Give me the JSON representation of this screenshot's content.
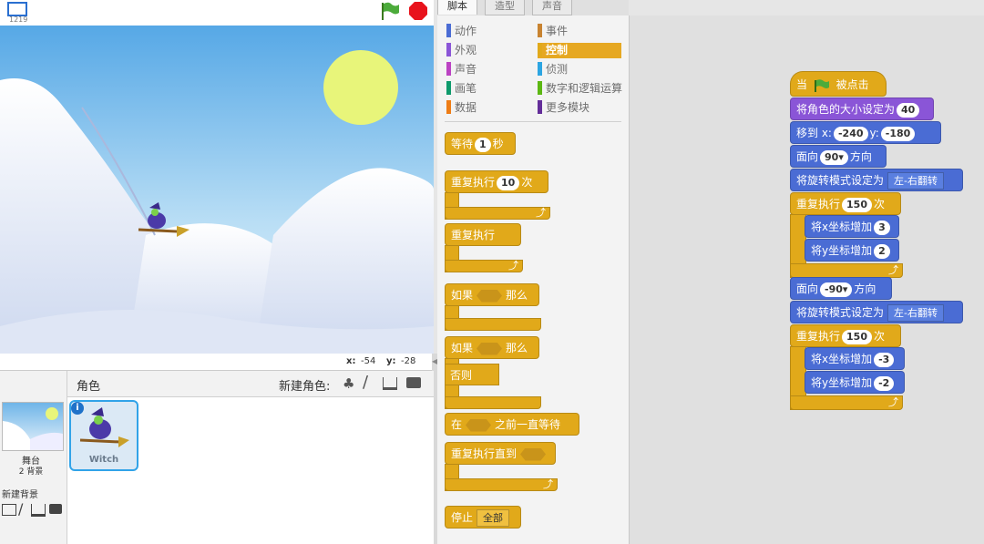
{
  "stage": {
    "version_label": "1219",
    "coord_x_label": "x:",
    "coord_x": "-54",
    "coord_y_label": "y:",
    "coord_y": "-28"
  },
  "sprites": {
    "header_label": "角色",
    "new_sprite_label": "新建角色:",
    "stage_item_label": "舞台",
    "stage_backdrops": "2 背景",
    "new_backdrop_label": "新建背景",
    "sprite_name": "Witch"
  },
  "tabs": [
    {
      "label": "脚本"
    },
    {
      "label": "造型"
    },
    {
      "label": "声音"
    }
  ],
  "categories": [
    {
      "label": "动作",
      "color": "#4a6cd4"
    },
    {
      "label": "事件",
      "color": "#c88330"
    },
    {
      "label": "外观",
      "color": "#8a55d7"
    },
    {
      "label": "控制",
      "color": "#e1a91a"
    },
    {
      "label": "声音",
      "color": "#bb42c3"
    },
    {
      "label": "侦测",
      "color": "#2ca5e2"
    },
    {
      "label": "画笔",
      "color": "#0e9a6c"
    },
    {
      "label": "数字和逻辑运算",
      "color": "#5cb712"
    },
    {
      "label": "数据",
      "color": "#ee7d16"
    },
    {
      "label": "更多模块",
      "color": "#632d99"
    }
  ],
  "palette": {
    "wait_label": "等待",
    "wait_value": "1",
    "wait_unit": "秒",
    "repeat_label": "重复执行",
    "repeat_value": "10",
    "repeat_unit": "次",
    "forever_label": "重复执行",
    "if_label": "如果",
    "then_label": "那么",
    "if2_label": "如果",
    "then2_label": "那么",
    "else_label": "否则",
    "wait_until_pre": "在",
    "wait_until_post": "之前一直等待",
    "repeat_until_label": "重复执行直到",
    "stop_label": "停止",
    "stop_value": "全部"
  },
  "script": {
    "hat_pre": "当",
    "hat_post": "被点击",
    "set_size_label": "将角色的大小设定为",
    "set_size_value": "40",
    "goto_label": "移到 x:",
    "goto_x": "-240",
    "goto_y_label": "y:",
    "goto_y": "-180",
    "point1_label": "面向",
    "point1_value": "90▾",
    "point1_suffix": "方向",
    "rotation1_label": "将旋转模式设定为",
    "rotation1_value": "左-右翻转",
    "repeat1_label": "重复执行",
    "repeat1_value": "150",
    "repeat1_unit": "次",
    "changex1_label": "将x坐标增加",
    "changex1_value": "3",
    "changey1_label": "将y坐标增加",
    "changey1_value": "2",
    "point2_label": "面向",
    "point2_value": "-90▾",
    "point2_suffix": "方向",
    "rotation2_label": "将旋转模式设定为",
    "rotation2_value": "左-右翻转",
    "repeat2_label": "重复执行",
    "repeat2_value": "150",
    "repeat2_unit": "次",
    "changex2_label": "将x坐标增加",
    "changex2_value": "-3",
    "changey2_label": "将y坐标增加",
    "changey2_value": "-2"
  }
}
